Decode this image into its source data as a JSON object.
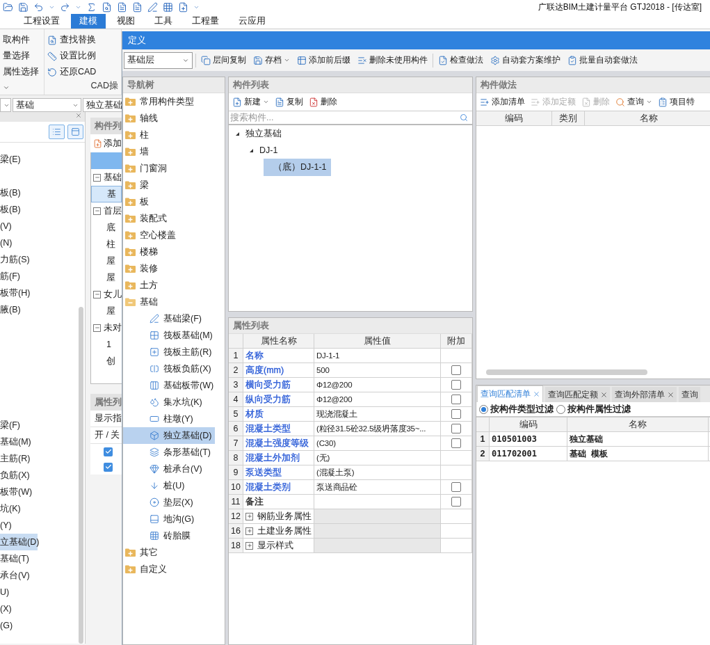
{
  "app_title": "广联达BIM土建计量平台 GTJ2018 - [传达室]",
  "menu": [
    {
      "label": "工程设置",
      "selected": false
    },
    {
      "label": "建模",
      "selected": true
    },
    {
      "label": "视图",
      "selected": false
    },
    {
      "label": "工具",
      "selected": false
    },
    {
      "label": "工程量",
      "selected": false
    },
    {
      "label": "云应用",
      "selected": false
    }
  ],
  "ribbon": [
    {
      "items": [
        "取构件",
        "量选择",
        "属性选择"
      ]
    },
    {
      "items": [
        "查找替换",
        "设置比例",
        "还原CAD"
      ],
      "label": "CAD操"
    }
  ],
  "selectors": [
    "基础",
    "独立基础"
  ],
  "left_panel": {
    "groups": [
      {
        "items": [
          {
            "label": "梁(E)",
            "selected": false
          }
        ]
      },
      {
        "items": [
          {
            "label": "板(B)",
            "selected": false
          },
          {
            "label": "板(B)",
            "selected": false
          },
          {
            "label": "(V)",
            "selected": false
          },
          {
            "label": "(N)",
            "selected": false
          },
          {
            "label": "力筋(S)",
            "selected": false
          },
          {
            "label": "筋(F)",
            "selected": false
          },
          {
            "label": "板带(H)",
            "selected": false
          },
          {
            "label": "腋(B)",
            "selected": false
          }
        ]
      },
      {
        "items": [
          {
            "label": "梁(F)",
            "selected": false
          },
          {
            "label": "基础(M)",
            "selected": false
          },
          {
            "label": "主筋(R)",
            "selected": false
          },
          {
            "label": "负筋(X)",
            "selected": false
          },
          {
            "label": "板带(W)",
            "selected": false
          },
          {
            "label": "坑(K)",
            "selected": false
          },
          {
            "label": "(Y)",
            "selected": false
          },
          {
            "label": "立基础(D)",
            "selected": true
          },
          {
            "label": "基础(T)",
            "selected": false
          },
          {
            "label": "承台(V)",
            "selected": false
          },
          {
            "label": "U)",
            "selected": false
          },
          {
            "label": "(X)",
            "selected": false
          },
          {
            "label": "(G)",
            "selected": false
          }
        ]
      }
    ]
  },
  "floor_list": {
    "title": "构件列",
    "add": "添加",
    "rows": [
      {
        "kind": "group",
        "label": "基础",
        "expanded": true,
        "selected": false
      },
      {
        "kind": "leaf",
        "label": "基",
        "selected": true
      },
      {
        "kind": "group",
        "label": "首层",
        "expanded": true,
        "selected": false
      },
      {
        "kind": "leaf",
        "label": "底",
        "selected": false
      },
      {
        "kind": "leaf",
        "label": "柱",
        "selected": false
      },
      {
        "kind": "leaf",
        "label": "屋",
        "selected": false
      },
      {
        "kind": "leaf",
        "label": "屋",
        "selected": false
      },
      {
        "kind": "group",
        "label": "女儿",
        "expanded": true,
        "selected": false
      },
      {
        "kind": "leaf",
        "label": "屋",
        "selected": false
      },
      {
        "kind": "group",
        "label": "未对",
        "expanded": true,
        "selected": false
      },
      {
        "kind": "leaf",
        "label": "1",
        "selected": false
      },
      {
        "kind": "leaf",
        "label": "创",
        "selected": false
      }
    ]
  },
  "display_panel": {
    "title": "属性列",
    "row": "显示指",
    "header": "开 / 关",
    "checks": [
      {
        "checked": true
      },
      {
        "checked": true
      }
    ]
  },
  "dialog": {
    "title": "定义",
    "floor": "基础层",
    "toolbar": [
      {
        "label": "层间复制",
        "dropdown": false
      },
      {
        "label": "存档",
        "dropdown": true
      },
      {
        "label": "添加前后缀",
        "dropdown": false
      },
      {
        "label": "删除未使用构件",
        "dropdown": false
      },
      {
        "label": "检查做法",
        "dropdown": false
      },
      {
        "label": "自动套方案维护",
        "dropdown": false
      },
      {
        "label": "批量自动套做法",
        "dropdown": false
      }
    ],
    "nav": {
      "title": "导航树",
      "items": [
        {
          "label": "常用构件类型",
          "expanded": false
        },
        {
          "label": "轴线",
          "expanded": false
        },
        {
          "label": "柱",
          "expanded": false
        },
        {
          "label": "墙",
          "expanded": false
        },
        {
          "label": "门窗洞",
          "expanded": false
        },
        {
          "label": "梁",
          "expanded": false
        },
        {
          "label": "板",
          "expanded": false
        },
        {
          "label": "装配式",
          "expanded": false
        },
        {
          "label": "空心楼盖",
          "expanded": false
        },
        {
          "label": "楼梯",
          "expanded": false
        },
        {
          "label": "装修",
          "expanded": false
        },
        {
          "label": "土方",
          "expanded": false
        },
        {
          "label": "基础",
          "expanded": true,
          "children": [
            {
              "label": "基础梁(F)",
              "selected": false
            },
            {
              "label": "筏板基础(M)",
              "selected": false
            },
            {
              "label": "筏板主筋(R)",
              "selected": false
            },
            {
              "label": "筏板负筋(X)",
              "selected": false
            },
            {
              "label": "基础板带(W)",
              "selected": false
            },
            {
              "label": "集水坑(K)",
              "selected": false
            },
            {
              "label": "柱墩(Y)",
              "selected": false
            },
            {
              "label": "独立基础(D)",
              "selected": true
            },
            {
              "label": "条形基础(T)",
              "selected": false
            },
            {
              "label": "桩承台(V)",
              "selected": false
            },
            {
              "label": "桩(U)",
              "selected": false
            },
            {
              "label": "垫层(X)",
              "selected": false
            },
            {
              "label": "地沟(G)",
              "selected": false
            },
            {
              "label": "砖胎膜",
              "selected": false
            }
          ]
        },
        {
          "label": "其它",
          "expanded": false
        },
        {
          "label": "自定义",
          "expanded": false
        }
      ]
    },
    "components": {
      "title": "构件列表",
      "toolbar": [
        {
          "label": "新建",
          "dropdown": true
        },
        {
          "label": "复制",
          "dropdown": false
        },
        {
          "label": "删除",
          "dropdown": false
        }
      ],
      "search": {
        "placeholder": "搜索构件..."
      },
      "tree": [
        {
          "label": "独立基础",
          "expanded": true,
          "selected": false,
          "children": [
            {
              "label": "DJ-1",
              "expanded": true,
              "selected": false,
              "children": [
                {
                  "label": "（底）DJ-1-1",
                  "selected": true
                }
              ]
            }
          ]
        }
      ]
    },
    "properties": {
      "title": "属性列表",
      "columns": [
        "属性名称",
        "属性值",
        "附加"
      ],
      "rows": [
        {
          "num": "1",
          "kind": "field",
          "name": "名称",
          "color": "#2a5bd7",
          "value": "DJ-1-1"
        },
        {
          "num": "2",
          "kind": "field",
          "name": "高度(mm)",
          "color": "#2a5bd7",
          "value": "500",
          "checked": false
        },
        {
          "num": "3",
          "kind": "field",
          "name": "横向受力筋",
          "color": "#2a5bd7",
          "value": "Φ12@200",
          "checked": false
        },
        {
          "num": "4",
          "kind": "field",
          "name": "纵向受力筋",
          "color": "#2a5bd7",
          "value": "Φ12@200",
          "checked": false
        },
        {
          "num": "5",
          "kind": "field",
          "name": "材质",
          "color": "#2a5bd7",
          "value": "现浇混凝土",
          "checked": false
        },
        {
          "num": "6",
          "kind": "field",
          "name": "混凝土类型",
          "color": "#2a5bd7",
          "value": "(粒径31.5砼32.5级坍落度35~...",
          "checked": false
        },
        {
          "num": "7",
          "kind": "field",
          "name": "混凝土强度等级",
          "color": "#2a5bd7",
          "value": "(C30)",
          "checked": false
        },
        {
          "num": "8",
          "kind": "field",
          "name": "混凝土外加剂",
          "color": "#2a5bd7",
          "value": "(无)"
        },
        {
          "num": "9",
          "kind": "field",
          "name": "泵送类型",
          "color": "#2a5bd7",
          "value": "(混凝土泵)"
        },
        {
          "num": "10",
          "kind": "field",
          "name": "混凝土类别",
          "color": "#2a5bd7",
          "value": "泵送商品砼",
          "checked": false
        },
        {
          "num": "11",
          "kind": "field",
          "name": "备注",
          "color": "#222222",
          "checked": false
        },
        {
          "num": "12",
          "kind": "group",
          "name": "钢筋业务属性",
          "expanded": false
        },
        {
          "num": "16",
          "kind": "group",
          "name": "土建业务属性",
          "expanded": false
        },
        {
          "num": "18",
          "kind": "group",
          "name": "显示样式",
          "expanded": false
        }
      ]
    },
    "methods": {
      "title": "构件做法",
      "toolbar": [
        {
          "label": "添加清单",
          "disabled": false,
          "dropdown": false
        },
        {
          "label": "添加定额",
          "disabled": true,
          "dropdown": false
        },
        {
          "label": "删除",
          "disabled": true,
          "dropdown": false
        },
        {
          "label": "查询",
          "disabled": false,
          "dropdown": true
        },
        {
          "label": "项目特",
          "disabled": false,
          "dropdown": false
        }
      ],
      "columns": [
        "编码",
        "类别",
        "名称"
      ]
    },
    "query": {
      "tabs": [
        {
          "label": "查询匹配清单",
          "selected": true
        },
        {
          "label": "查询匹配定额",
          "selected": false
        },
        {
          "label": "查询外部清单",
          "selected": false
        },
        {
          "label": "查询",
          "selected": false
        }
      ],
      "filters": [
        {
          "label": "按构件类型过滤",
          "selected": true
        },
        {
          "label": "按构件属性过滤",
          "selected": false
        }
      ],
      "columns": [
        "编码",
        "名称"
      ],
      "rows": [
        {
          "num": "1",
          "code": "010501003",
          "name": "独立基础"
        },
        {
          "num": "2",
          "code": "011702001",
          "name": "基础 模板"
        }
      ]
    }
  }
}
